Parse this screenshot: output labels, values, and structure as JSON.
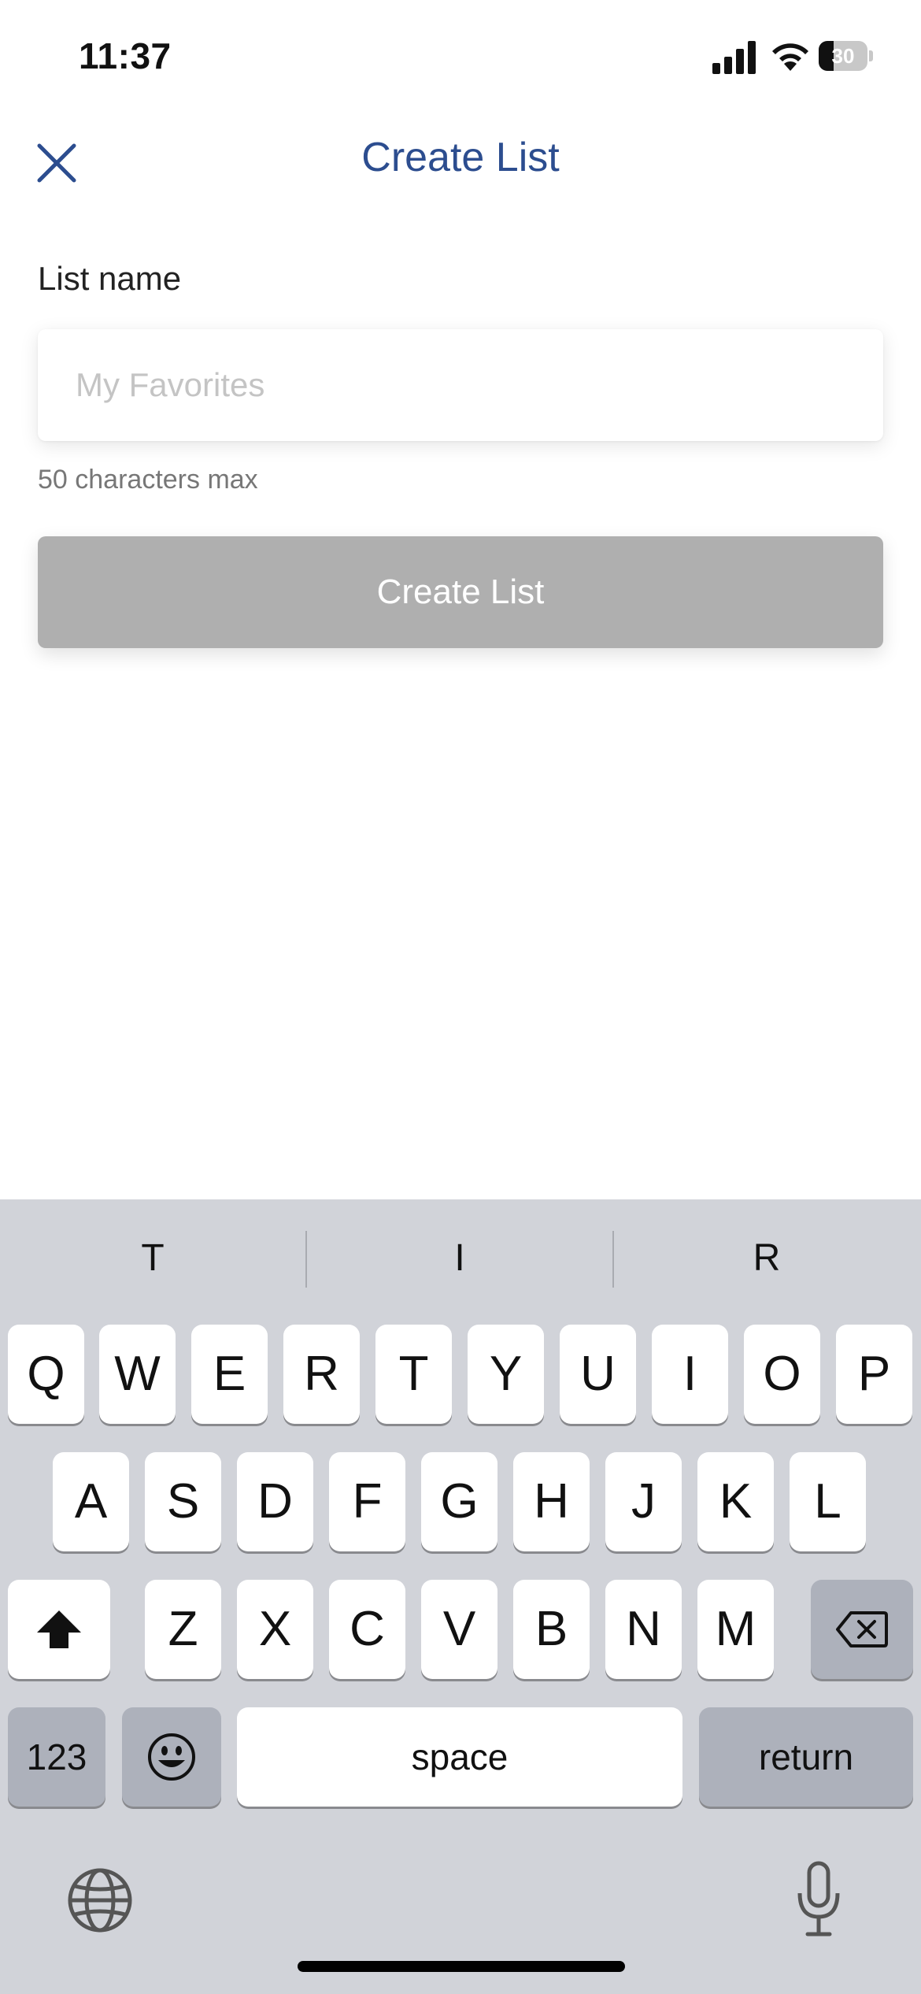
{
  "status_bar": {
    "time": "11:37",
    "battery_level": "30",
    "battery_fraction": 0.3
  },
  "header": {
    "title": "Create List",
    "close_icon": "close-icon"
  },
  "form": {
    "label": "List name",
    "input_value": "",
    "input_placeholder": "My Favorites",
    "hint": "50 characters max",
    "submit_label": "Create List",
    "submit_color": "#afafaf"
  },
  "keyboard": {
    "suggestions": [
      "T",
      "I",
      "R"
    ],
    "row1": [
      "Q",
      "W",
      "E",
      "R",
      "T",
      "Y",
      "U",
      "I",
      "O",
      "P"
    ],
    "row2": [
      "A",
      "S",
      "D",
      "F",
      "G",
      "H",
      "J",
      "K",
      "L"
    ],
    "row3": [
      "Z",
      "X",
      "C",
      "V",
      "B",
      "N",
      "M"
    ],
    "numbers_label": "123",
    "space_label": "space",
    "return_label": "return"
  },
  "colors": {
    "accent": "#2c4d8f",
    "keyboard_bg": "#d1d3d9"
  }
}
